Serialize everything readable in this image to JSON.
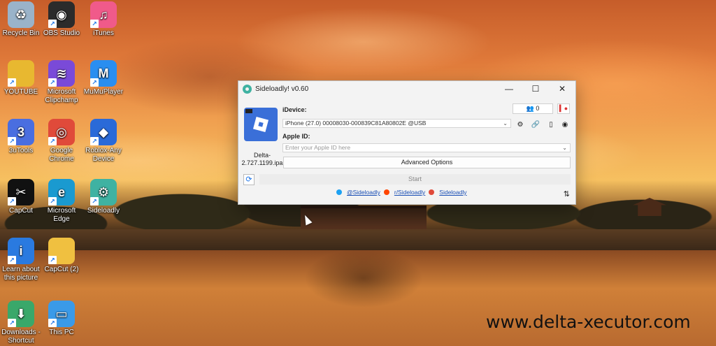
{
  "desktop": {
    "icons": [
      {
        "label": "Recycle Bin",
        "icon": "recycle-bin-icon",
        "color": "#9ab3c9",
        "glyph": "♻"
      },
      {
        "label": "OBS Studio",
        "icon": "obs-icon",
        "color": "#2b2b2b",
        "glyph": "◉"
      },
      {
        "label": "iTunes",
        "icon": "itunes-icon",
        "color": "#f05a8a",
        "glyph": "♫"
      },
      {
        "label": "YOUTUBE",
        "icon": "folder-icon",
        "color": "#e8b830",
        "glyph": ""
      },
      {
        "label": "Microsoft Clipchamp",
        "icon": "clipchamp-icon",
        "color": "#7a4ad8",
        "glyph": "≋"
      },
      {
        "label": "MuMuPlayer",
        "icon": "mumuplayer-icon",
        "color": "#2a8ef0",
        "glyph": "M"
      },
      {
        "label": "3uTools",
        "icon": "3utools-icon",
        "color": "#4a6ee0",
        "glyph": "3"
      },
      {
        "label": "Google Chrome",
        "icon": "chrome-icon",
        "color": "#e04a3a",
        "glyph": "◎"
      },
      {
        "label": "Roblox-Any Device",
        "icon": "roblox-icon",
        "color": "#2a6ad8",
        "glyph": "◆"
      },
      {
        "label": "CapCut",
        "icon": "capcut-icon",
        "color": "#111111",
        "glyph": "✂"
      },
      {
        "label": "Microsoft Edge",
        "icon": "edge-icon",
        "color": "#1a9ad0",
        "glyph": "e"
      },
      {
        "label": "Sideloadly",
        "icon": "sideloadly-icon",
        "color": "#3fb2a2",
        "glyph": "⚙"
      },
      {
        "label": "Learn about this picture",
        "icon": "info-icon",
        "color": "#2a7ae0",
        "glyph": "i"
      },
      {
        "label": "CapCut (2)",
        "icon": "folder-icon",
        "color": "#f0c040",
        "glyph": ""
      },
      {
        "label": "Downloads - Shortcut",
        "icon": "downloads-folder-icon",
        "color": "#3aa86a",
        "glyph": "⬇"
      },
      {
        "label": "This PC",
        "icon": "monitor-icon",
        "color": "#3a9ae8",
        "glyph": "▭"
      }
    ]
  },
  "window": {
    "title": "Sideloadly! v0.60",
    "minimize": "—",
    "maximize": "☐",
    "close": "✕",
    "ipa_name": "Delta-2.727.1199.ipa",
    "idevice_label": "iDevice:",
    "idevice_value": "iPhone (27.0) 00008030-000839C81A80802E @USB",
    "apple_id_label": "Apple ID:",
    "apple_id_placeholder": "Enter your Apple ID here",
    "advanced_options": "Advanced Options",
    "start": "Start",
    "counter": "0",
    "links": [
      "@Sideloadly",
      "r/Sideloadly",
      "Sideloadly"
    ]
  },
  "watermark": "www.delta-xecutor.com"
}
